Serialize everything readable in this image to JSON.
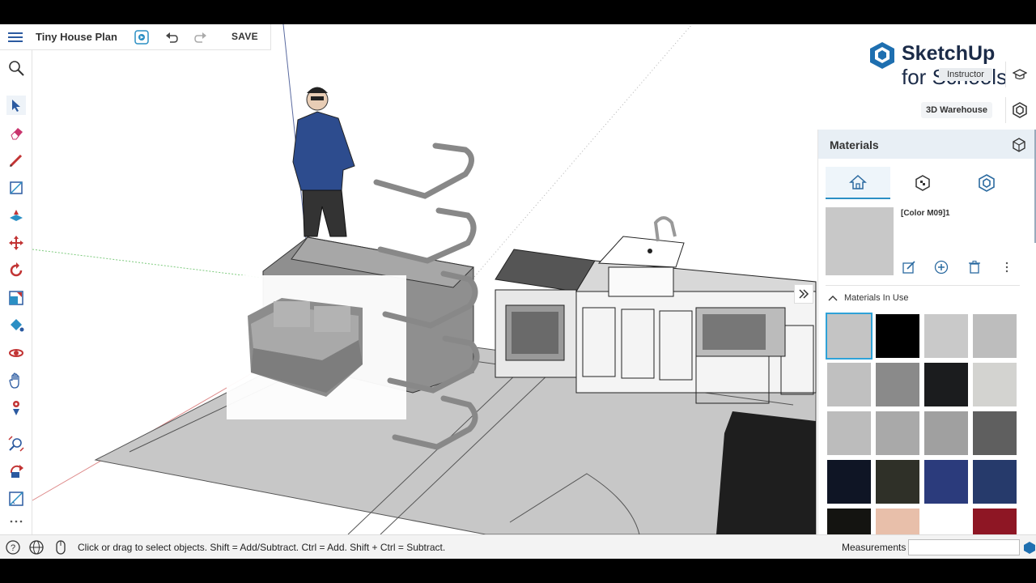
{
  "app": {
    "project_title": "Tiny House Plan",
    "save_label": "SAVE",
    "logo_line1": "SketchUp",
    "logo_line2": "for Schools",
    "instructor_label": "Instructor",
    "warehouse_label": "3D Warehouse"
  },
  "left_toolbar": {
    "tools": [
      "search-icon",
      "select-icon",
      "eraser-icon",
      "pencil-icon",
      "rectangle-icon",
      "push-pull-icon",
      "move-icon",
      "rotate-icon",
      "scale-icon",
      "paint-bucket-icon",
      "orbit-icon",
      "pan-icon",
      "walk-icon",
      "zoom-icon",
      "look-around-icon",
      "tape-measure-icon",
      "more-icon"
    ]
  },
  "materials": {
    "title": "Materials",
    "selected_name": "[Color M09]1",
    "section_label": "Materials In Use",
    "tabs": [
      "home-icon",
      "texture-cube-icon",
      "warehouse-icon"
    ],
    "swatches": [
      "#c4c4c4",
      "#000000",
      "#c9c9c9",
      "#bdbdbd",
      "#c0c0c0",
      "#8a8a8a",
      "#1b1c1e",
      "#d3d3d0",
      "#bcbcbc",
      "#a9a9a9",
      "#a0a0a0",
      "#5f5f5f",
      "#0f1525",
      "#2f3028",
      "#2b3b7c",
      "#263a6b",
      "#141411",
      "#e8bfaa",
      "#ffffff",
      "#8e1624"
    ]
  },
  "status": {
    "hint": "Click or drag to select objects. Shift = Add/Subtract. Ctrl = Add. Shift + Ctrl = Subtract.",
    "measurements_label": "Measurements",
    "measurements_value": ""
  },
  "colors": {
    "accent": "#2b8fc4",
    "header_bg": "#e8eff5",
    "logo_blue": "#1e6fb0"
  }
}
